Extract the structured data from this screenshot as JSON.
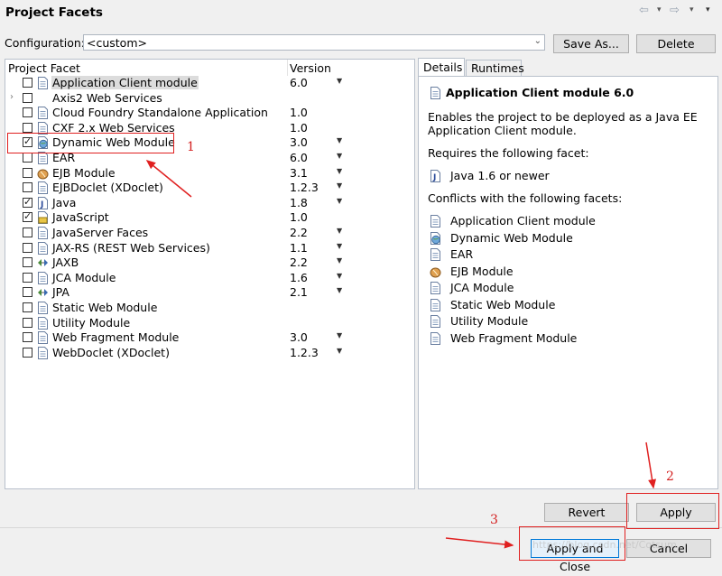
{
  "window": {
    "title": "Project Facets"
  },
  "toolbar": {
    "back_icon": "⇦",
    "menu_arrow": "▾",
    "forward_icon": "⇨"
  },
  "config": {
    "label": "Configuration:",
    "value": "<custom>",
    "save_label": "Save As...",
    "delete_label": "Delete"
  },
  "table": {
    "col_facet": "Project Facet",
    "col_version": "Version",
    "rows": [
      {
        "name": "Application Client module",
        "version": "6.0",
        "checked": false,
        "selected": true,
        "dropdown": true,
        "expander": false,
        "icon": "page-icon"
      },
      {
        "name": "Axis2 Web Services",
        "version": "",
        "checked": false,
        "selected": false,
        "dropdown": false,
        "expander": true,
        "icon": "none"
      },
      {
        "name": "Cloud Foundry Standalone Application",
        "version": "1.0",
        "checked": false,
        "selected": false,
        "dropdown": false,
        "expander": false,
        "icon": "page-icon"
      },
      {
        "name": "CXF 2.x Web Services",
        "version": "1.0",
        "checked": false,
        "selected": false,
        "dropdown": false,
        "expander": false,
        "icon": "page-icon"
      },
      {
        "name": "Dynamic Web Module",
        "version": "3.0",
        "checked": true,
        "selected": false,
        "dropdown": true,
        "expander": false,
        "icon": "globe-page-icon"
      },
      {
        "name": "EAR",
        "version": "6.0",
        "checked": false,
        "selected": false,
        "dropdown": true,
        "expander": false,
        "icon": "page-icon"
      },
      {
        "name": "EJB Module",
        "version": "3.1",
        "checked": false,
        "selected": false,
        "dropdown": true,
        "expander": false,
        "icon": "bean-icon"
      },
      {
        "name": "EJBDoclet (XDoclet)",
        "version": "1.2.3",
        "checked": false,
        "selected": false,
        "dropdown": true,
        "expander": false,
        "icon": "page-icon"
      },
      {
        "name": "Java",
        "version": "1.8",
        "checked": true,
        "selected": false,
        "dropdown": true,
        "expander": false,
        "icon": "java-icon"
      },
      {
        "name": "JavaScript",
        "version": "1.0",
        "checked": true,
        "selected": false,
        "dropdown": false,
        "expander": false,
        "icon": "javascript-icon"
      },
      {
        "name": "JavaServer Faces",
        "version": "2.2",
        "checked": false,
        "selected": false,
        "dropdown": true,
        "expander": false,
        "icon": "page-icon"
      },
      {
        "name": "JAX-RS (REST Web Services)",
        "version": "1.1",
        "checked": false,
        "selected": false,
        "dropdown": true,
        "expander": false,
        "icon": "page-icon"
      },
      {
        "name": "JAXB",
        "version": "2.2",
        "checked": false,
        "selected": false,
        "dropdown": true,
        "expander": false,
        "icon": "arrows-icon"
      },
      {
        "name": "JCA Module",
        "version": "1.6",
        "checked": false,
        "selected": false,
        "dropdown": true,
        "expander": false,
        "icon": "page-icon"
      },
      {
        "name": "JPA",
        "version": "2.1",
        "checked": false,
        "selected": false,
        "dropdown": true,
        "expander": false,
        "icon": "arrows-icon"
      },
      {
        "name": "Static Web Module",
        "version": "",
        "checked": false,
        "selected": false,
        "dropdown": false,
        "expander": false,
        "icon": "page-icon"
      },
      {
        "name": "Utility Module",
        "version": "",
        "checked": false,
        "selected": false,
        "dropdown": false,
        "expander": false,
        "icon": "page-icon"
      },
      {
        "name": "Web Fragment Module",
        "version": "3.0",
        "checked": false,
        "selected": false,
        "dropdown": true,
        "expander": false,
        "icon": "page-icon"
      },
      {
        "name": "WebDoclet (XDoclet)",
        "version": "1.2.3",
        "checked": false,
        "selected": false,
        "dropdown": true,
        "expander": false,
        "icon": "page-icon"
      }
    ]
  },
  "tabs": {
    "details": "Details",
    "runtimes": "Runtimes"
  },
  "details": {
    "title": "Application Client module 6.0",
    "description_line1": "Enables the project to be deployed as a Java EE",
    "description_line2": "Application Client module.",
    "requires_label": "Requires the following facet:",
    "requires_item": "Java 1.6 or newer",
    "conflicts_label": "Conflicts with the following facets:",
    "conflicts": [
      {
        "name": "Application Client module",
        "icon": "page-icon"
      },
      {
        "name": "Dynamic Web Module",
        "icon": "globe-page-icon"
      },
      {
        "name": "EAR",
        "icon": "page-icon"
      },
      {
        "name": "EJB Module",
        "icon": "bean-icon"
      },
      {
        "name": "JCA Module",
        "icon": "page-icon"
      },
      {
        "name": "Static Web Module",
        "icon": "page-icon"
      },
      {
        "name": "Utility Module",
        "icon": "page-icon"
      },
      {
        "name": "Web Fragment Module",
        "icon": "page-icon"
      }
    ]
  },
  "buttons": {
    "revert": "Revert",
    "apply": "Apply",
    "apply_close": "Apply and Close",
    "cancel": "Cancel"
  },
  "annotations": {
    "n1": "1",
    "n2": "2",
    "n3": "3"
  },
  "watermark": "https://blog.csdn.net/Cotsum",
  "colors": {
    "annotation_red": "#e02020",
    "selection": "#dcdcdc"
  }
}
